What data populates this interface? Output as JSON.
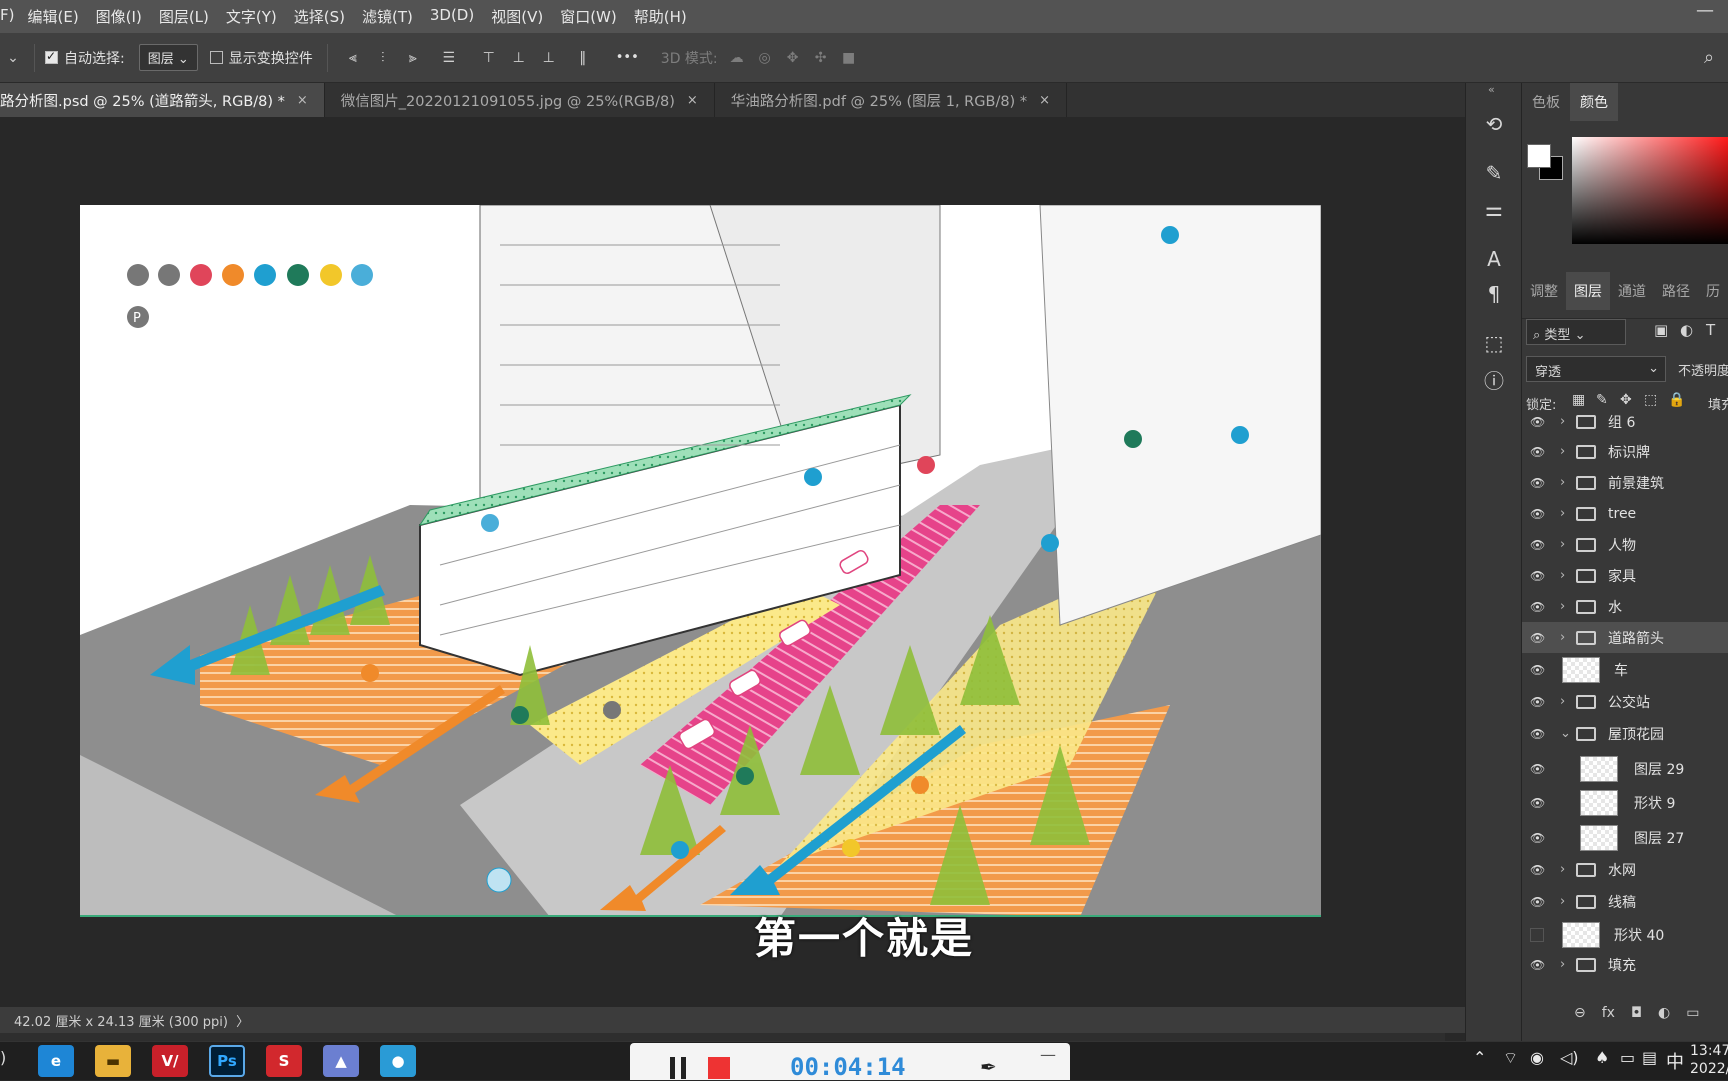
{
  "menu": [
    "F)",
    "编辑(E)",
    "图像(I)",
    "图层(L)",
    "文字(Y)",
    "选择(S)",
    "滤镜(T)",
    "3D(D)",
    "视图(V)",
    "窗口(W)",
    "帮助(H)"
  ],
  "options": {
    "auto_select_label": "自动选择:",
    "auto_select_value": "图层",
    "show_transform_label": "显示变换控件",
    "three_d_mode_label": "3D 模式:",
    "more": "•••"
  },
  "tabs": [
    {
      "label": "路分析图.psd @ 25% (道路箭头, RGB/8) *",
      "active": true
    },
    {
      "label": "微信图片_20220121091055.jpg @ 25%(RGB/8)",
      "active": false
    },
    {
      "label": "华油路分析图.pdf @ 25% (图层 1, RGB/8) *",
      "active": false
    }
  ],
  "tab_close": "×",
  "subtitle": "第一个就是",
  "status": {
    "doc_size": "42.02 厘米 x 24.13 厘米 (300 ppi)",
    "arrow": "〉"
  },
  "color_panel": {
    "tabs": [
      "色板",
      "颜色"
    ],
    "active": "颜色"
  },
  "layers_panel": {
    "tabs": [
      "调整",
      "图层",
      "通道",
      "路径",
      "历"
    ],
    "active": "图层",
    "filter_label": "类型",
    "blend_mode": "穿透",
    "opacity_label": "不透明度",
    "lock_label": "锁定:",
    "fill_label": "填充"
  },
  "layers": [
    {
      "name": "组 6",
      "kind": "folder",
      "expanded": false,
      "visible": true,
      "indent": 0
    },
    {
      "name": "标识牌",
      "kind": "folder",
      "expanded": false,
      "visible": true,
      "indent": 0
    },
    {
      "name": "前景建筑",
      "kind": "folder",
      "expanded": false,
      "visible": true,
      "indent": 0
    },
    {
      "name": "tree",
      "kind": "folder",
      "expanded": false,
      "visible": true,
      "indent": 0
    },
    {
      "name": "人物",
      "kind": "folder",
      "expanded": false,
      "visible": true,
      "indent": 0
    },
    {
      "name": "家具",
      "kind": "folder",
      "expanded": false,
      "visible": true,
      "indent": 0
    },
    {
      "name": "水",
      "kind": "folder",
      "expanded": false,
      "visible": true,
      "indent": 0
    },
    {
      "name": "道路箭头",
      "kind": "folder",
      "expanded": false,
      "visible": true,
      "indent": 0,
      "selected": true
    },
    {
      "name": "车",
      "kind": "layer",
      "visible": true,
      "indent": 0
    },
    {
      "name": "公交站",
      "kind": "folder",
      "expanded": false,
      "visible": true,
      "indent": 0
    },
    {
      "name": "屋顶花园",
      "kind": "folder",
      "expanded": true,
      "visible": true,
      "indent": 0
    },
    {
      "name": "图层 29",
      "kind": "layer",
      "visible": true,
      "indent": 1
    },
    {
      "name": "形状 9",
      "kind": "shape",
      "visible": true,
      "indent": 1
    },
    {
      "name": "图层 27",
      "kind": "layer",
      "visible": true,
      "indent": 1
    },
    {
      "name": "水网",
      "kind": "folder",
      "expanded": false,
      "visible": true,
      "indent": 0
    },
    {
      "name": "线稿",
      "kind": "folder",
      "expanded": false,
      "visible": true,
      "indent": 0
    },
    {
      "name": "形状 40",
      "kind": "shape",
      "visible": false,
      "indent": 0
    },
    {
      "name": "填充",
      "kind": "folder",
      "expanded": false,
      "visible": true,
      "indent": 0
    }
  ],
  "layer_footer": [
    "⊖",
    "fx",
    "◘",
    "◐",
    "▭"
  ],
  "taskbar": {
    "apps": [
      {
        "name": "edge",
        "glyph": "e"
      },
      {
        "name": "explorer",
        "glyph": "▬"
      },
      {
        "name": "vray",
        "glyph": "V/"
      },
      {
        "name": "photoshop",
        "glyph": "Ps"
      },
      {
        "name": "sketchup",
        "glyph": "S"
      },
      {
        "name": "app",
        "glyph": "▲"
      },
      {
        "name": "recorder",
        "glyph": "●"
      }
    ],
    "record_time": "00:04:14",
    "ime": "中",
    "clock_time": "13:47",
    "clock_date": "2022/"
  },
  "colors": {
    "accent": "#1f9fd0",
    "orange": "#f08a2a",
    "pink": "#e0457f",
    "green": "#3aaa7a"
  }
}
